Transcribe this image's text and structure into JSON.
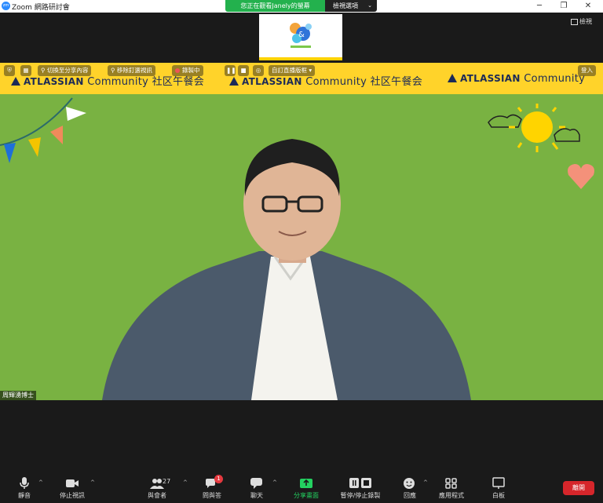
{
  "titlebar": {
    "app_icon_text": "zm",
    "title": "Zoom 網路研討會",
    "share_status": "您正在觀看Janely的螢幕",
    "view_options": "檢視選項",
    "minimize": "─",
    "restore": "❐",
    "close": "✕"
  },
  "top_strip": {
    "view_toggle": "檢視"
  },
  "screen": {
    "banner_brand": "ATLASSIAN",
    "banner_community": "Community 社区午餐会",
    "controls": {
      "switch_content": "切換至分享內容",
      "remove_video": "移除釘選視訊",
      "recording": "錄製中",
      "customize": "自訂直播版框",
      "enter": "登入"
    },
    "speaker_name": "周輝湧博士"
  },
  "toolbar": {
    "mute": "靜音",
    "stop_video": "停止視訊",
    "participants": "與會者",
    "participant_count": "27",
    "qa": "問與答",
    "qa_badge": "1",
    "chat": "聊天",
    "share_screen": "分享畫面",
    "pause_stop_recording": "暫停/停止錄製",
    "reactions": "回應",
    "apps": "應用程式",
    "whiteboard": "白板",
    "leave": "離開"
  },
  "colors": {
    "screen_green": "#79b242",
    "banner_yellow": "#ffd32a",
    "share_green": "#23b14d",
    "leave_red": "#d6262b"
  }
}
